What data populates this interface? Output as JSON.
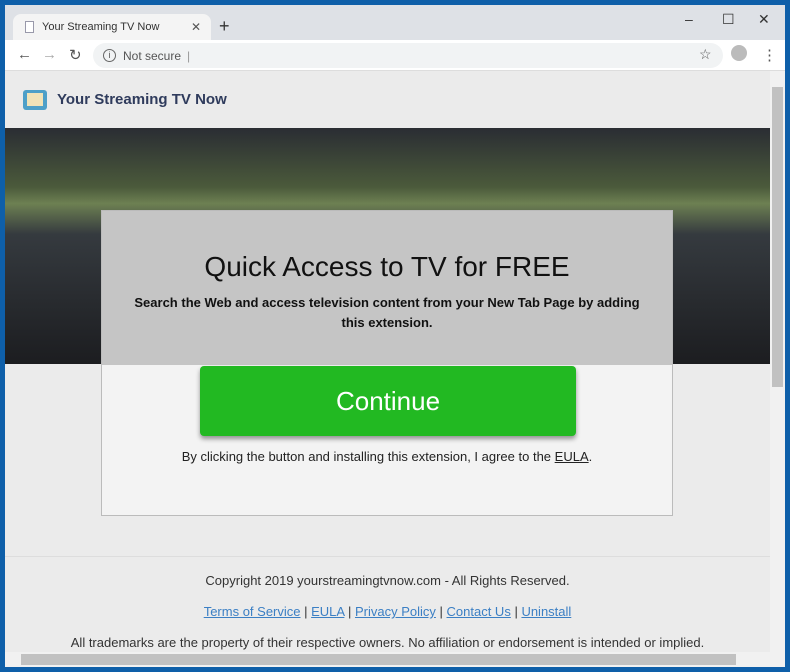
{
  "browser": {
    "tab_title": "Your Streaming TV Now",
    "address": "Not secure"
  },
  "header": {
    "brand": "Your Streaming TV Now"
  },
  "offer": {
    "title": "Quick Access to TV for FREE",
    "subtitle": "Search the Web and access television content from your New Tab Page by adding this extension.",
    "button": "Continue",
    "agree_prefix": "By clicking the button and installing this extension, I agree to the ",
    "agree_link": "EULA",
    "agree_suffix": "."
  },
  "footer": {
    "copyright": "Copyright 2019 yourstreamingtvnow.com - All Rights Reserved.",
    "links": [
      "Terms of Service",
      "EULA",
      "Privacy Policy",
      "Contact Us",
      "Uninstall"
    ],
    "separator": " | ",
    "disclaimer": "All trademarks are the property of their respective owners. No affiliation or endorsement is intended or implied."
  },
  "colors": {
    "button": "#22b922",
    "link": "#3b7fc4",
    "frame": "#0e5fa9"
  }
}
